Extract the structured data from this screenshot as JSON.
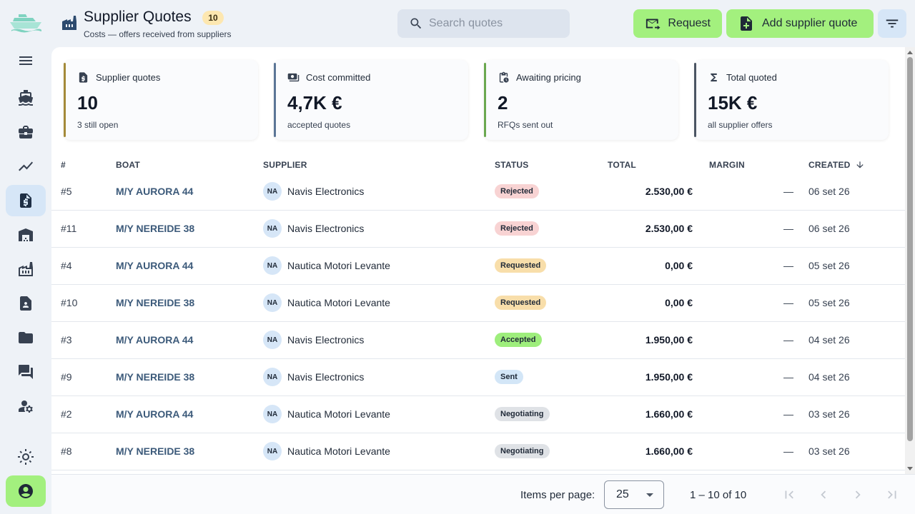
{
  "colors": {
    "accent_green": "#a3f07e",
    "active_blue": "#d6e6f7",
    "card_accent_1": "#a48a3a",
    "card_accent_2": "#5b7596",
    "card_accent_3": "#6aa84f",
    "card_accent_4": "#4b5563"
  },
  "sidebar": {
    "logo_icon": "boat-logo-icon",
    "items": [
      {
        "icon": "menu-icon"
      },
      {
        "icon": "boat-icon"
      },
      {
        "icon": "briefcase-icon"
      },
      {
        "icon": "trending-icon"
      },
      {
        "icon": "quote-document-icon",
        "active": true
      },
      {
        "icon": "warehouse-icon"
      },
      {
        "icon": "factory-icon"
      },
      {
        "icon": "contact-document-icon"
      },
      {
        "icon": "folder-icon"
      },
      {
        "icon": "chat-icon"
      },
      {
        "icon": "user-settings-icon"
      }
    ],
    "theme_icon": "sun-icon",
    "account_icon": "account-icon"
  },
  "header": {
    "icon": "factory-icon",
    "title": "Supplier Quotes",
    "count_badge": "10",
    "subtitle": "Costs — offers received from suppliers",
    "search_placeholder": "Search quotes",
    "search_value": "",
    "request_label": "Request",
    "add_label": "Add supplier quote",
    "filter_icon": "filter-icon"
  },
  "cards": [
    {
      "label": "Supplier quotes",
      "value": "10",
      "caption": "3 still open",
      "icon": "quote-document-icon"
    },
    {
      "label": "Cost committed",
      "value": "4,7K €",
      "caption": "accepted quotes",
      "icon": "money-icon"
    },
    {
      "label": "Awaiting pricing",
      "value": "2",
      "caption": "RFQs sent out",
      "icon": "pending-clipboard-icon"
    },
    {
      "label": "Total quoted",
      "value": "15K €",
      "caption": "all supplier offers",
      "icon": "sigma-icon"
    }
  ],
  "table": {
    "columns": {
      "num": "#",
      "boat": "BOAT",
      "supplier": "SUPPLIER",
      "status": "STATUS",
      "total": "TOTAL",
      "margin": "MARGIN",
      "created": "CREATED"
    },
    "sort_icon": "arrow-down-icon",
    "rows": [
      {
        "num": "#5",
        "boat": "M/Y AURORA 44",
        "initials": "NA",
        "supplier": "Navis Electronics",
        "status": "Rejected",
        "status_color": "#f8d3d3",
        "total": "2.530,00 €",
        "margin": "—",
        "created": "06 set 26"
      },
      {
        "num": "#11",
        "boat": "M/Y NEREIDE 38",
        "initials": "NA",
        "supplier": "Navis Electronics",
        "status": "Rejected",
        "status_color": "#f8d3d3",
        "total": "2.530,00 €",
        "margin": "—",
        "created": "06 set 26"
      },
      {
        "num": "#4",
        "boat": "M/Y AURORA 44",
        "initials": "NA",
        "supplier": "Nautica Motori Levante",
        "status": "Requested",
        "status_color": "#f8deaa",
        "total": "0,00 €",
        "margin": "—",
        "created": "05 set 26"
      },
      {
        "num": "#10",
        "boat": "M/Y NEREIDE 38",
        "initials": "NA",
        "supplier": "Nautica Motori Levante",
        "status": "Requested",
        "status_color": "#f8deaa",
        "total": "0,00 €",
        "margin": "—",
        "created": "05 set 26"
      },
      {
        "num": "#3",
        "boat": "M/Y AURORA 44",
        "initials": "NA",
        "supplier": "Navis Electronics",
        "status": "Accepted",
        "status_color": "#9eee7c",
        "total": "1.950,00 €",
        "margin": "—",
        "created": "04 set 26"
      },
      {
        "num": "#9",
        "boat": "M/Y NEREIDE 38",
        "initials": "NA",
        "supplier": "Navis Electronics",
        "status": "Sent",
        "status_color": "#d3e6f7",
        "total": "1.950,00 €",
        "margin": "—",
        "created": "04 set 26"
      },
      {
        "num": "#2",
        "boat": "M/Y AURORA 44",
        "initials": "NA",
        "supplier": "Nautica Motori Levante",
        "status": "Negotiating",
        "status_color": "#dfe2e6",
        "total": "1.660,00 €",
        "margin": "—",
        "created": "03 set 26"
      },
      {
        "num": "#8",
        "boat": "M/Y NEREIDE 38",
        "initials": "NA",
        "supplier": "Nautica Motori Levante",
        "status": "Negotiating",
        "status_color": "#dfe2e6",
        "total": "1.660,00 €",
        "margin": "—",
        "created": "03 set 26"
      }
    ]
  },
  "paginator": {
    "items_per_page_label": "Items per page:",
    "items_per_page_value": "25",
    "range_label": "1 – 10 of 10"
  }
}
